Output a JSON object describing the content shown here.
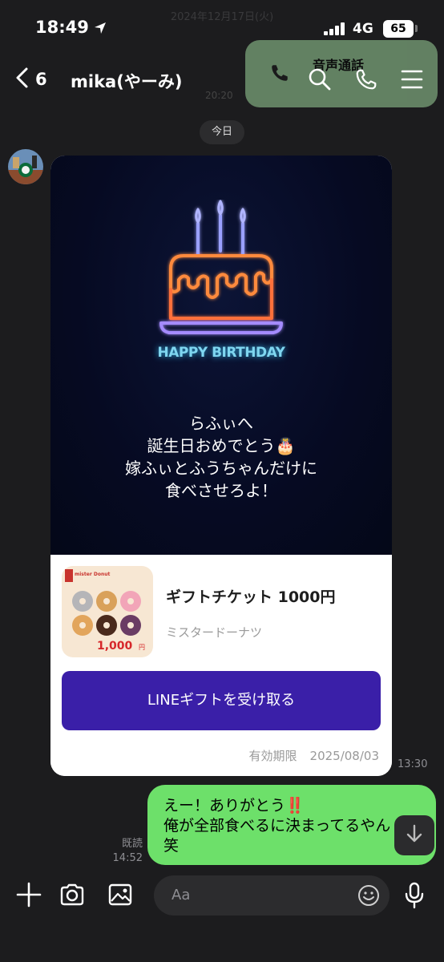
{
  "status": {
    "time": "18:49",
    "network": "4G",
    "battery": "65"
  },
  "ghost": {
    "date": "2024年12月17日(火)",
    "call_label": "音声通話",
    "time": "20:20"
  },
  "header": {
    "back_count": "6",
    "title": "mika(やーみ)"
  },
  "date_pill": "今日",
  "card": {
    "headline": "HAPPY BIRTHDAY",
    "message_lines": [
      "らふぃへ",
      "誕生日おめでとう🎂",
      "嫁ふぃとふうちゃんだけに",
      "食べさせろよ！"
    ],
    "gift_title": "ギフトチケット 1000円",
    "gift_brand": "ミスタードーナツ",
    "thumb_brand": "mister Donut",
    "thumb_price": "1,000",
    "thumb_unit": "円",
    "button_label": "LINEギフトを受け取る",
    "expiry_label": "有効期限",
    "expiry_date": "2025/08/03",
    "time": "13:30"
  },
  "outgoing": {
    "lines": [
      "えー！ありがとう‼️",
      "俺が全部食べるに決まってるやん",
      "笑"
    ],
    "read_label": "既読",
    "time": "14:52"
  },
  "composer": {
    "placeholder": "Aa"
  },
  "colors": {
    "bubble_out": "#6de06a",
    "gift_button": "#3a1fa8",
    "background": "#1c1c1e"
  },
  "icons": [
    "location-arrow-icon",
    "signal-icon",
    "chevron-left-icon",
    "search-icon",
    "phone-icon",
    "menu-icon",
    "arrow-down-icon",
    "plus-icon",
    "camera-icon",
    "image-icon",
    "emoji-icon",
    "mic-icon"
  ]
}
